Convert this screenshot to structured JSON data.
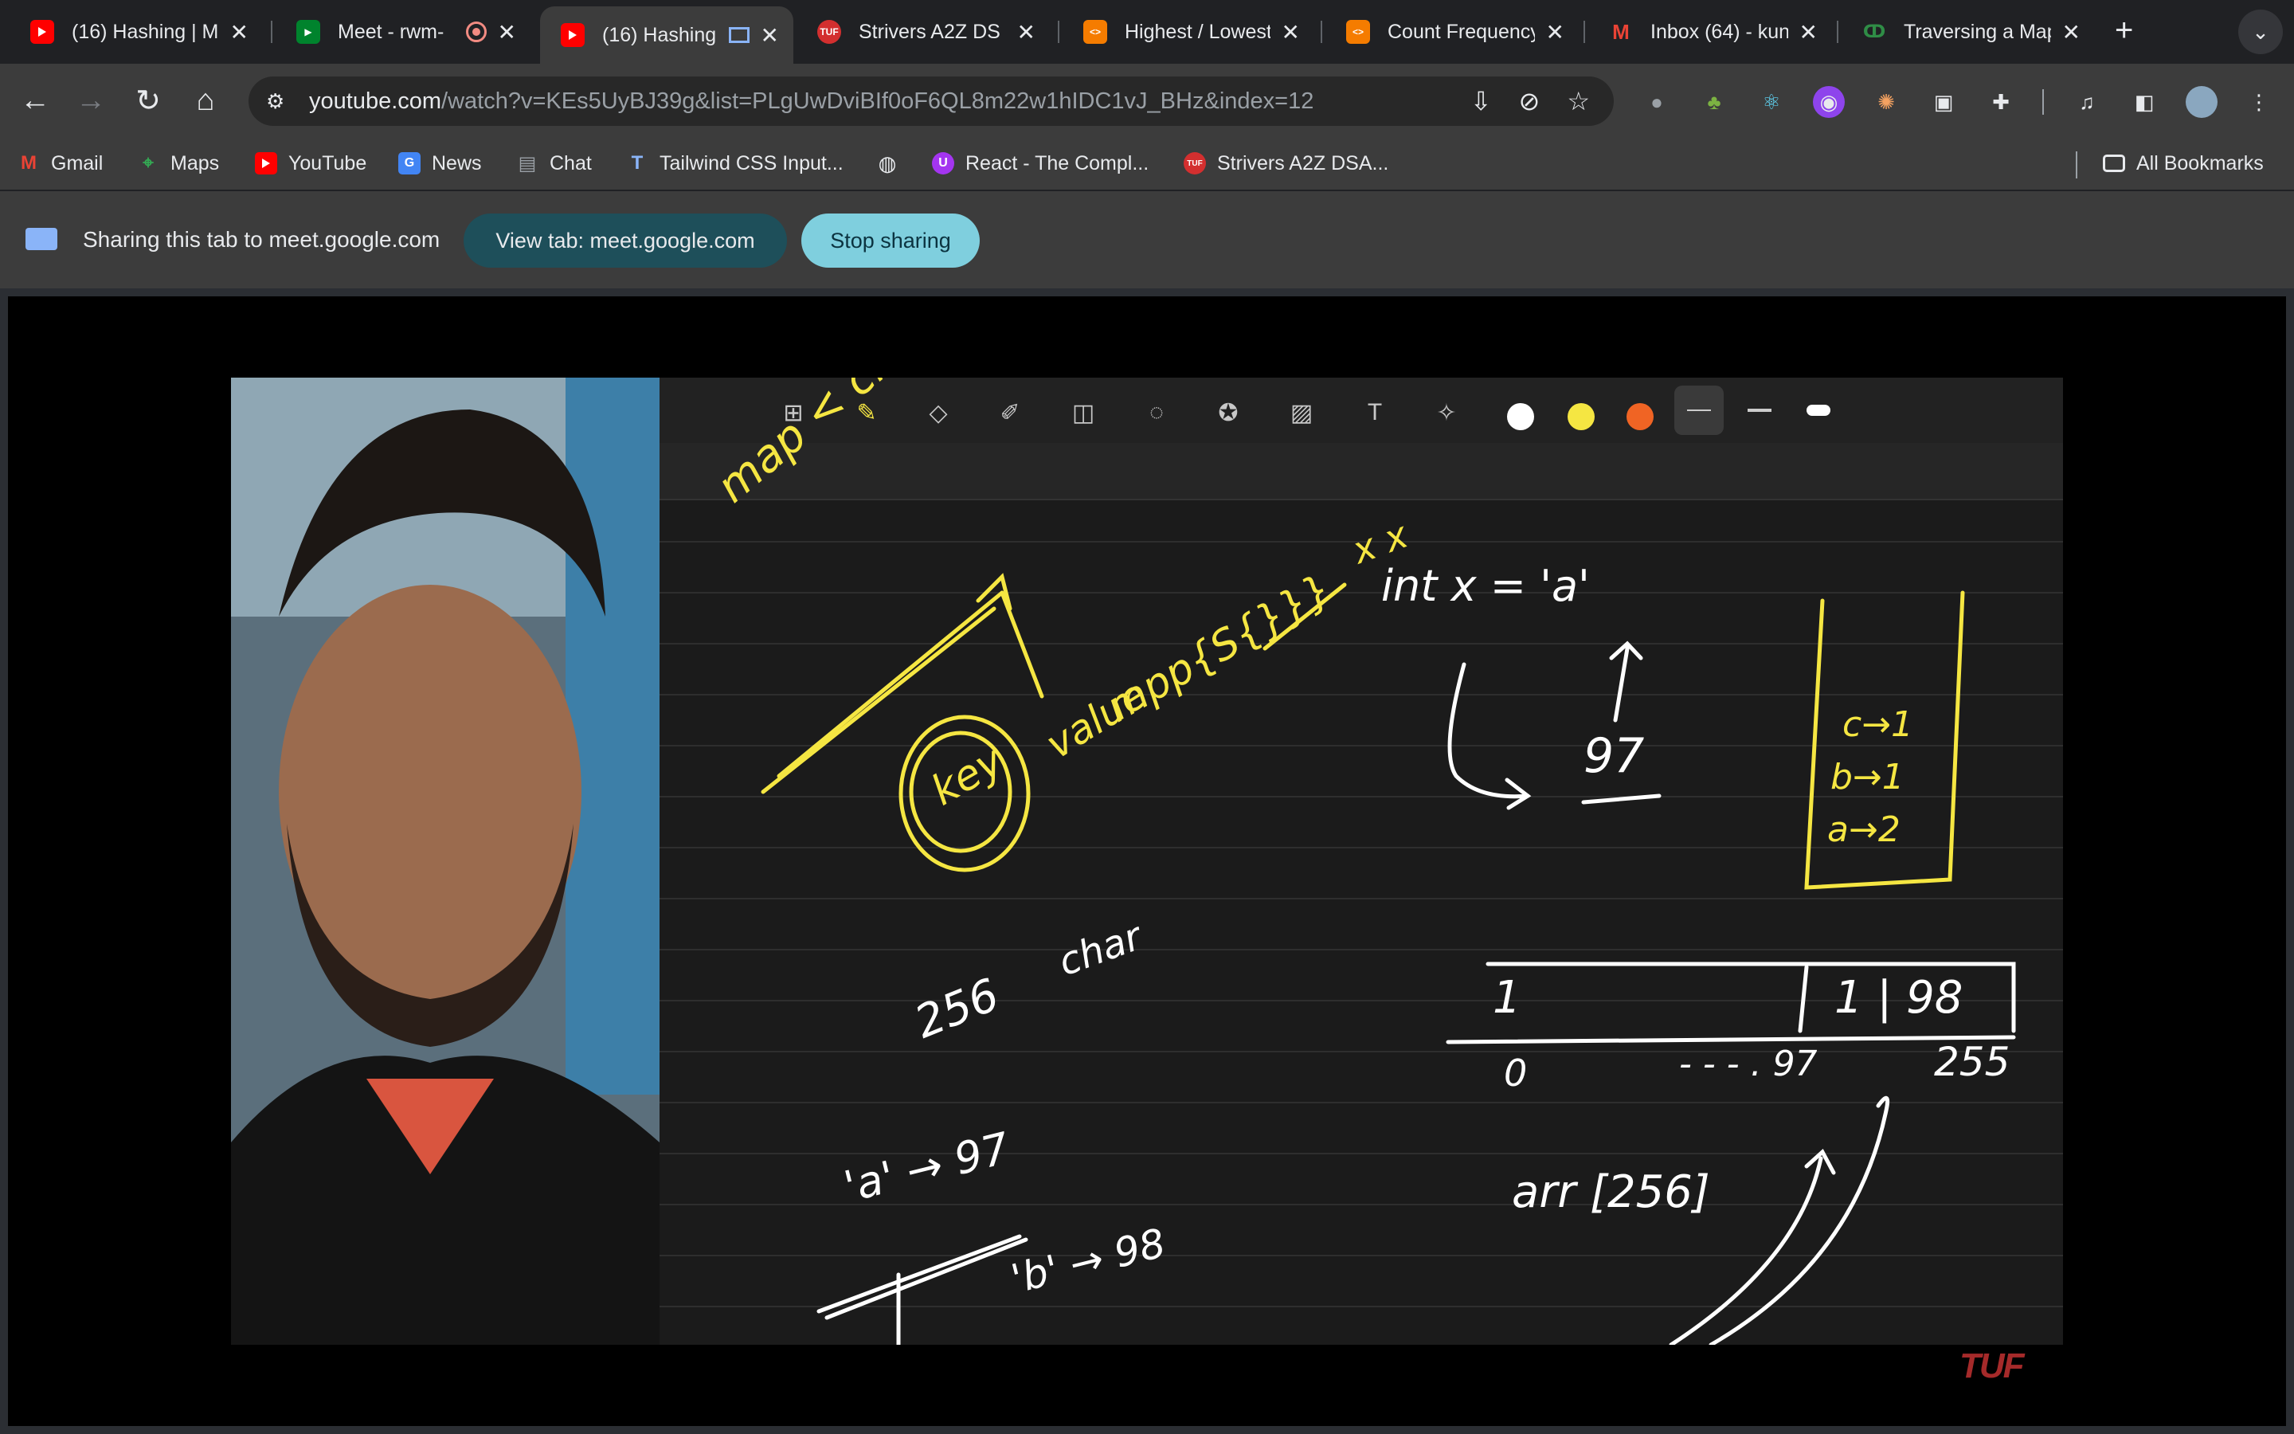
{
  "tabs": [
    {
      "title": "(16) Hashing | M",
      "favicon": "youtube-icon"
    },
    {
      "title": "Meet - rwm-",
      "favicon": "meet-icon"
    },
    {
      "title": "(16) Hashing",
      "favicon": "youtube-icon",
      "active": true
    },
    {
      "title": "Strivers A2Z DS",
      "favicon": "tuf-icon"
    },
    {
      "title": "Highest / Lowest",
      "favicon": "codestudio-icon"
    },
    {
      "title": "Count Frequency",
      "favicon": "codestudio-icon"
    },
    {
      "title": "Inbox (64) - kun",
      "favicon": "gmail-icon"
    },
    {
      "title": "Traversing a Map",
      "favicon": "gfg-icon"
    }
  ],
  "address_bar": {
    "host": "youtube.com",
    "path": "/watch?v=KEs5UyBJ39g&list=PLgUwDviBIf0oF6QL8m22w1hIDC1vJ_BHz&index=12"
  },
  "bookmarks": [
    {
      "label": "Gmail",
      "icon": "gmail-icon"
    },
    {
      "label": "Maps",
      "icon": "maps-icon"
    },
    {
      "label": "YouTube",
      "icon": "youtube-icon"
    },
    {
      "label": "News",
      "icon": "news-icon"
    },
    {
      "label": "Chat",
      "icon": "chat-icon"
    },
    {
      "label": "Tailwind CSS Input...",
      "icon": "tailwind-icon"
    },
    {
      "label": "",
      "icon": "globe-icon"
    },
    {
      "label": "React - The Compl...",
      "icon": "udemy-icon"
    },
    {
      "label": "Strivers A2Z DSA...",
      "icon": "tuf-icon"
    },
    {
      "label": "All Bookmarks",
      "icon": "folder-icon"
    }
  ],
  "sharing": {
    "message": "Sharing this tab to meet.google.com",
    "view_button": "View tab: meet.google.com",
    "stop_button": "Stop sharing"
  },
  "whiteboard": {
    "colors": [
      "#ffffff",
      "#f5e642",
      "#f06424"
    ],
    "notes": {
      "map": "map < char, int >",
      "key": "key",
      "value": "value",
      "mpp": "mpp{S{}}}",
      "xx": "x x",
      "int_x": "int x = 'a'",
      "n97": "97",
      "map_c": "c→1",
      "map_b": "b→1",
      "map_a": "a→2",
      "n256": "256",
      "char": "char",
      "one": "1",
      "one98": "1 | 98",
      "zero": "0",
      "n97b": "- - - . 97",
      "n255": "255",
      "a97": "'a' → 97",
      "b98": "'b' → 98",
      "arr": "arr [256]"
    }
  },
  "watermark": "TUF"
}
